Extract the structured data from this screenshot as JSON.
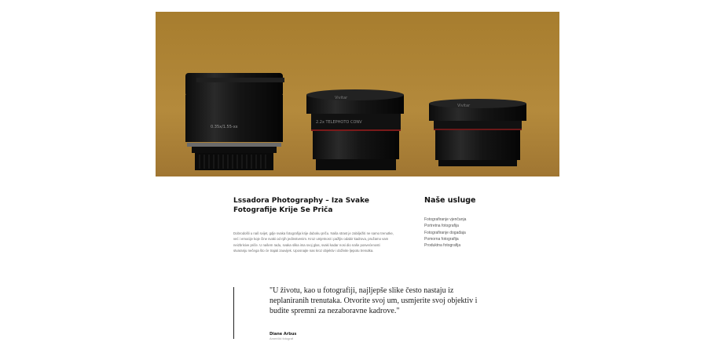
{
  "hero": {
    "image_alt": "camera-lenses-photo",
    "lens_labels": [
      "0.35x/1.55-xx",
      "Vivitar",
      "Vivitar"
    ],
    "lens_ring_text": "2.2x TELEPHOTO CONV"
  },
  "intro": {
    "title": "Lssadora Photography – Iza Svake Fotografije Krije Se Priča",
    "body": "Dobrodošli u naš svijet, gdje svaka fotografija krije duboku priču. Naša strast je zabilježiti ne samo trenutke, već i emocije koje čine svaki od njih jedinstvenim. Kroz umjetnost i pažljiv odabir kadrova, pružamo vam neizbrisive priče. U našem radu, svaka slika ima svoj glas, svaki kadar nosi dio naše posvećenosti stvaranju nečega što će trajati zauvijek. Uposnajte nas kroz objektiv i doživite ljepotu trenutka."
  },
  "services": {
    "title": "Naše usluge",
    "items": [
      "Fotografiranje vjenčanja",
      "Portretna fotografija",
      "Fotografiranje događaja",
      "Pomorna fotografija",
      "Produktna fotografija"
    ]
  },
  "quote": {
    "text": "\"U životu, kao u fotografiji, najljepše slike često nastaju iz neplaniranih trenutaka. Otvorite svoj um, usmjerite svoj objektiv i budite spremni za nezaboravne kadrove.\"",
    "author": "Diane Arbus",
    "role": "Američki fotograf"
  }
}
